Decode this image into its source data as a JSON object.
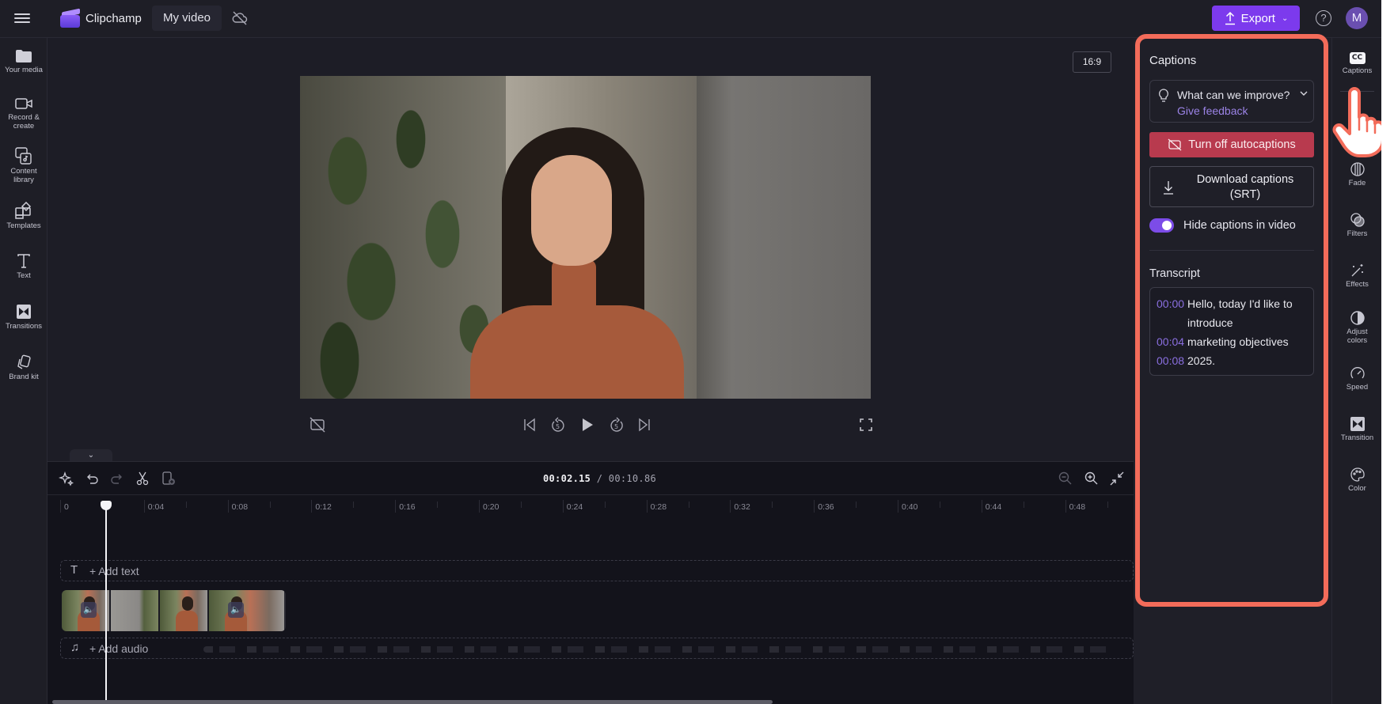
{
  "topbar": {
    "app_name": "Clipchamp",
    "project_name": "My video",
    "export_label": "Export",
    "help_label": "?",
    "avatar_initial": "M"
  },
  "sidebar": {
    "items": [
      {
        "label": "Your media",
        "icon": "folder-icon"
      },
      {
        "label": "Record & create",
        "icon": "camera-icon"
      },
      {
        "label": "Content library",
        "icon": "content-library-icon"
      },
      {
        "label": "Templates",
        "icon": "templates-icon"
      },
      {
        "label": "Text",
        "icon": "text-icon"
      },
      {
        "label": "Transitions",
        "icon": "transitions-icon"
      },
      {
        "label": "Brand kit",
        "icon": "brand-kit-icon"
      }
    ]
  },
  "preview": {
    "aspect_ratio": "16:9"
  },
  "timeline": {
    "current_time": "00:02.15",
    "separator": "/",
    "total_time": "00:10.86",
    "ruler_ticks": [
      "0",
      "0:04",
      "0:08",
      "0:12",
      "0:16",
      "0:20",
      "0:24",
      "0:28",
      "0:32",
      "0:36",
      "0:40",
      "0:44",
      "0:48"
    ],
    "add_text_label": "+ Add text",
    "add_audio_label": "+ Add audio"
  },
  "captions_panel": {
    "title": "Captions",
    "feedback_question": "What can we improve?",
    "feedback_link": "Give feedback",
    "turn_off_label": "Turn off autocaptions",
    "download_label_line1": "Download captions",
    "download_label_line2": "(SRT)",
    "hide_captions_label": "Hide captions in video",
    "hide_captions_on": true,
    "transcript_title": "Transcript",
    "transcript": [
      {
        "time": "00:00",
        "text": "Hello, today I'd like to introduce"
      },
      {
        "time": "00:04",
        "text": "marketing objectives"
      },
      {
        "time": "00:08",
        "text": "2025."
      }
    ]
  },
  "right_strip": {
    "items": [
      {
        "label": "Captions",
        "icon": "cc-icon",
        "active": true
      },
      {
        "label": "Fade",
        "icon": "fade-icon"
      },
      {
        "label": "Filters",
        "icon": "filters-icon"
      },
      {
        "label": "Effects",
        "icon": "effects-icon"
      },
      {
        "label": "Adjust colors",
        "icon": "adjust-colors-icon"
      },
      {
        "label": "Speed",
        "icon": "speed-icon"
      },
      {
        "label": "Transition",
        "icon": "transition-icon"
      },
      {
        "label": "Color",
        "icon": "color-palette-icon"
      }
    ]
  },
  "colors": {
    "accent": "#7c3aed",
    "danger_button": "#b83a4e",
    "highlight_outline": "#f36c5a",
    "timestamp": "#8a6fe0"
  }
}
